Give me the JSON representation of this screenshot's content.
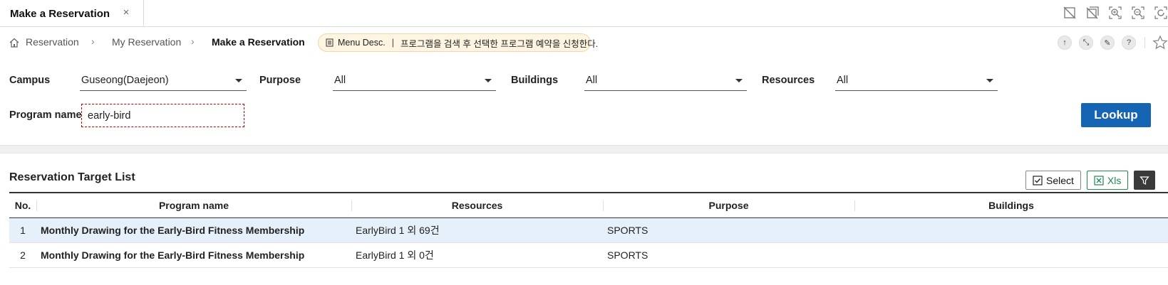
{
  "tab": {
    "title": "Make a Reservation",
    "close_glyph": "×"
  },
  "toolbar_icons": [
    "window-off-icon",
    "window-close-all-icon",
    "zoom-in-icon",
    "zoom-out-icon",
    "zoom-reset-icon"
  ],
  "breadcrumb": {
    "items": [
      "Reservation",
      "My Reservation",
      "Make a Reservation"
    ],
    "separator": "›"
  },
  "menu_desc": {
    "label": "Menu Desc.",
    "separator": "|",
    "text": "프로그램을 검색 후 선택한 프로그램 예약을 신청한다."
  },
  "help_buttons": [
    "↑",
    "⤡",
    "✎",
    "?"
  ],
  "filters": {
    "campus": {
      "label": "Campus",
      "value": "Guseong(Daejeon)"
    },
    "purpose": {
      "label": "Purpose",
      "value": "All"
    },
    "buildings": {
      "label": "Buildings",
      "value": "All"
    },
    "resources": {
      "label": "Resources",
      "value": "All"
    },
    "program_name": {
      "label": "Program name",
      "value": "early-bird"
    }
  },
  "lookup_label": "Lookup",
  "list": {
    "title": "Reservation Target List",
    "select_label": "Select",
    "xls_label": "Xls",
    "columns": [
      "No.",
      "Program name",
      "Resources",
      "Purpose",
      "Buildings"
    ],
    "rows": [
      {
        "no": "1",
        "program": "Monthly Drawing for the Early-Bird Fitness Membership",
        "resources": "EarlyBird 1 외 69건",
        "purpose": "SPORTS",
        "buildings": ""
      },
      {
        "no": "2",
        "program": "Monthly Drawing for the Early-Bird Fitness Membership",
        "resources": "EarlyBird 1 외 0건",
        "purpose": "SPORTS",
        "buildings": ""
      }
    ]
  },
  "colors": {
    "accent": "#1664b4",
    "selected_row": "#e6f0fa",
    "menu_desc_bg": "#fdf5e1",
    "xls_green": "#1f8a4c"
  }
}
